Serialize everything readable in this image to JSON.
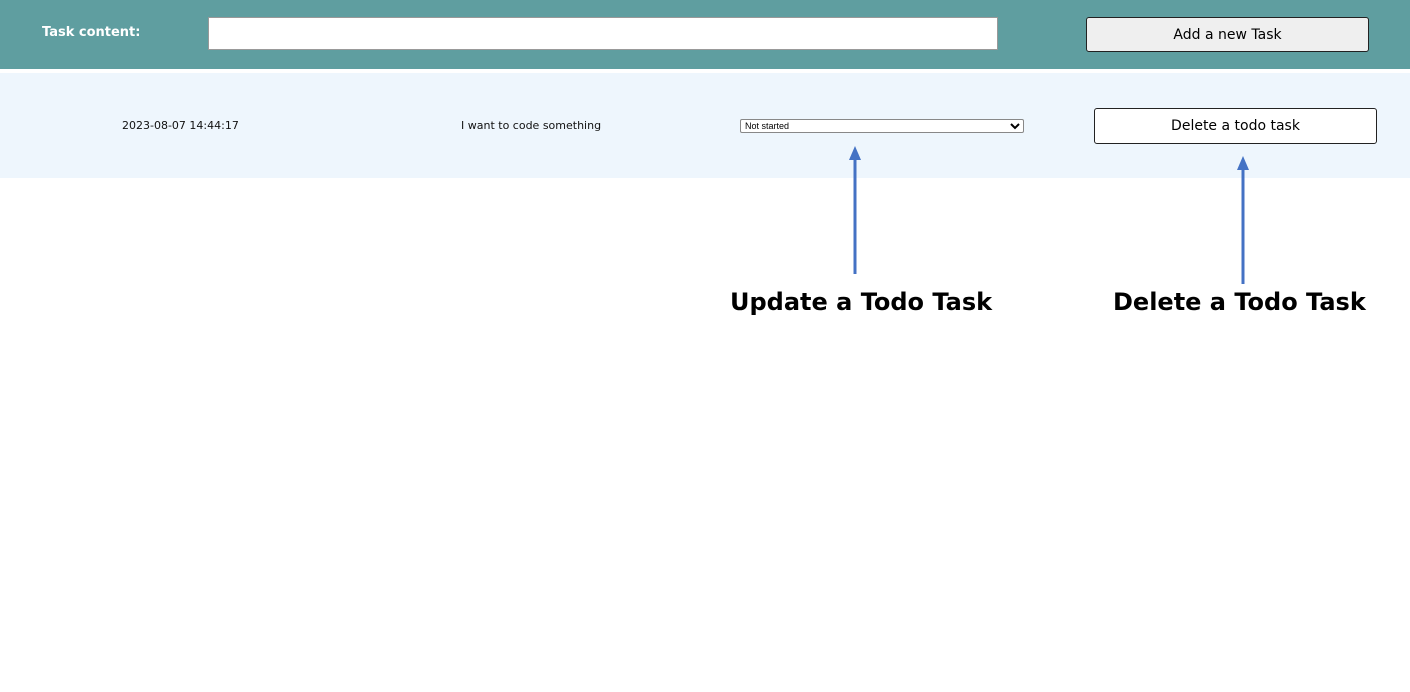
{
  "header": {
    "task_label": "Task content:",
    "task_input_value": "",
    "add_button": "Add a new Task"
  },
  "tasks": [
    {
      "date": "2023-08-07 14:44:17",
      "content": "I want to code something",
      "status": "Not started",
      "delete_button": "Delete a todo task"
    }
  ],
  "annotations": {
    "update": "Update a Todo Task",
    "delete": "Delete a Todo Task",
    "arrow_color": "#4472c4"
  }
}
